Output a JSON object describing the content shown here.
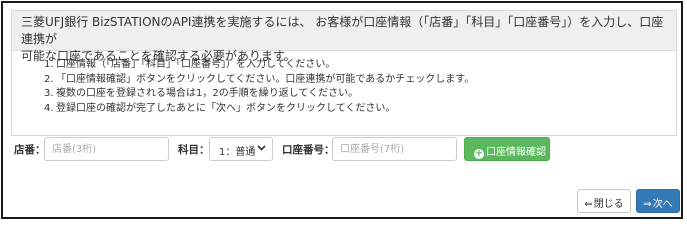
{
  "notice": {
    "intro_line1": "三菱UFJ銀行 BizSTATIONのAPI連携を実施するには、 お客様が口座情報（「店番」「科目」「口座番号」）を入力し、口座連携が",
    "intro_line2": "可能な口座であることを確認する必要があります。",
    "steps": [
      {
        "num": "1.",
        "text": "口座情報（「店番」「科目」「口座番号」）を入力してください。"
      },
      {
        "num": "2.",
        "text": "「口座情報確認」ボタンをクリックしてください。口座連携が可能であるかチェックします。"
      },
      {
        "num": "3.",
        "text": "複数の口座を登録される場合は1，2の手順を繰り返してください。"
      },
      {
        "num": "4.",
        "text": "登録口座の確認が完了したあとに「次へ」ボタンをクリックしてください。"
      }
    ]
  },
  "form": {
    "branch_label": "店番：",
    "branch_placeholder": "店番(3桁)",
    "subject_label": "科目：",
    "subject_value": "1：普通",
    "account_label": "口座番号：",
    "account_placeholder": "口座番号(7桁)",
    "check_button_label": "口座情報確認"
  },
  "footer": {
    "back_label": "閉じる",
    "next_label": "次へ"
  },
  "icons": {
    "check_button_icon": "plus-circle-icon",
    "back_icon": "arrow-left-icon",
    "next_icon": "arrow-right-icon",
    "select_icon": "chevron-down-icon"
  },
  "colors": {
    "header_bg": "#efefef",
    "green_button": "#5cb85c",
    "next_button": "#337ab7"
  }
}
